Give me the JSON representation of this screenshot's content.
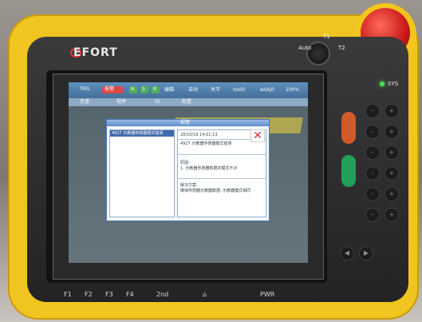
{
  "device": {
    "brand": "EFORT",
    "mode_labels": [
      "Auto",
      "T1",
      "T2"
    ],
    "led_label": "SYS",
    "keypad_left": [
      "-",
      "-",
      "-",
      "-",
      "-",
      "-"
    ],
    "keypad_right": [
      "+",
      "+",
      "+",
      "+",
      "+",
      "+"
    ],
    "nav_arrows": [
      "◀",
      "▶"
    ],
    "function_keys": [
      "F1",
      "F2",
      "F3",
      "F4",
      "2nd",
      "⌂",
      "PWR"
    ]
  },
  "screen": {
    "top_bar": {
      "left_text": "TRIL",
      "alarm_label": "报警",
      "chips": [
        "A",
        "S",
        "R"
      ],
      "items": [
        "编辑",
        "自动",
        "关节",
        "tool0",
        "wobj0",
        "100%"
      ]
    },
    "tabs": [
      "变量",
      "程序",
      "IO",
      "配置"
    ],
    "dialog": {
      "title": "报警",
      "list_selected": "4927  示教器传感器模式错误",
      "detail_time": "28/10/19 14:01:13",
      "detail_title": "4927  示教器传感器模式错误",
      "reason_label": "原因:",
      "reason_text": "1. 示教器传感器数据的模式不对",
      "solution_label": "解决方案:",
      "solution_text": "确保传感器示教器数据, 示教器模式相同"
    }
  }
}
